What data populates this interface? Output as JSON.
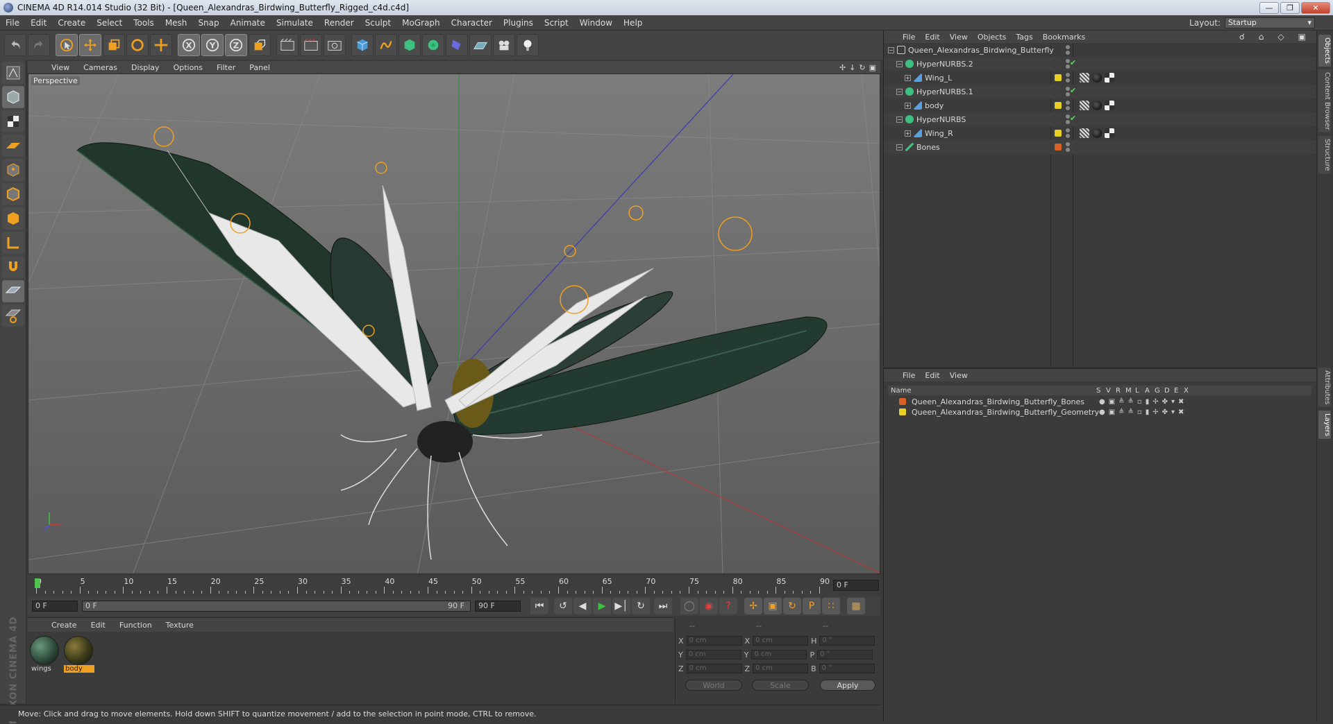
{
  "window": {
    "title": "CINEMA 4D R14.014 Studio (32 Bit) - [Queen_Alexandras_Birdwing_Butterfly_Rigged_c4d.c4d]"
  },
  "menu": [
    "File",
    "Edit",
    "Create",
    "Select",
    "Tools",
    "Mesh",
    "Snap",
    "Animate",
    "Simulate",
    "Render",
    "Sculpt",
    "MoGraph",
    "Character",
    "Plugins",
    "Script",
    "Window",
    "Help"
  ],
  "layout": {
    "label": "Layout:",
    "value": "Startup"
  },
  "viewport": {
    "menu": [
      "View",
      "Cameras",
      "Display",
      "Options",
      "Filter",
      "Panel"
    ],
    "label": "Perspective"
  },
  "timeline": {
    "ticks": [
      "0",
      "5",
      "10",
      "15",
      "20",
      "25",
      "30",
      "35",
      "40",
      "45",
      "50",
      "55",
      "60",
      "65",
      "70",
      "75",
      "80",
      "85",
      "90"
    ],
    "current_frame": "0 F",
    "start": "0 F",
    "range_start": "0 F",
    "range_end": "90 F",
    "end": "90 F"
  },
  "material_manager": {
    "menu": [
      "Create",
      "Edit",
      "Function",
      "Texture"
    ],
    "materials": [
      {
        "name": "wings",
        "selected": false,
        "color": "#2e4a3a"
      },
      {
        "name": "body",
        "selected": true,
        "color": "#3a3a18"
      }
    ]
  },
  "attributes": {
    "header": [
      "--",
      "--",
      "--"
    ],
    "rows": [
      {
        "a": "X",
        "av": "0 cm",
        "b": "X",
        "bv": "0 cm",
        "c": "H",
        "cv": "0 °"
      },
      {
        "a": "Y",
        "av": "0 cm",
        "b": "Y",
        "bv": "0 cm",
        "c": "P",
        "cv": "0 °"
      },
      {
        "a": "Z",
        "av": "0 cm",
        "b": "Z",
        "bv": "0 cm",
        "c": "B",
        "cv": "0 °"
      }
    ],
    "coord_mode": "World",
    "size_mode": "Scale",
    "apply": "Apply"
  },
  "status": "Move: Click and drag to move elements. Hold down SHIFT to quantize movement / add to the selection in point mode, CTRL to remove.",
  "brand": "MAXON CINEMA 4D",
  "object_manager": {
    "menu": [
      "File",
      "Edit",
      "View",
      "Objects",
      "Tags",
      "Bookmarks"
    ],
    "objects": [
      {
        "name": "Queen_Alexandras_Birdwing_Butterfly",
        "depth": 0,
        "layer": "",
        "check": false
      },
      {
        "name": "HyperNURBS.2",
        "depth": 1,
        "layer": "",
        "check": true
      },
      {
        "name": "Wing_L",
        "depth": 2,
        "layer": "#e8d020",
        "check": false,
        "tags": true
      },
      {
        "name": "HyperNURBS.1",
        "depth": 1,
        "layer": "",
        "check": true
      },
      {
        "name": "body",
        "depth": 2,
        "layer": "#e8d020",
        "check": false,
        "tags": true
      },
      {
        "name": "HyperNURBS",
        "depth": 1,
        "layer": "",
        "check": true
      },
      {
        "name": "Wing_R",
        "depth": 2,
        "layer": "#e8d020",
        "check": false,
        "tags": true
      },
      {
        "name": "Bones",
        "depth": 1,
        "layer": "#d86020",
        "check": false
      }
    ]
  },
  "layer_manager": {
    "menu": [
      "File",
      "Edit",
      "View"
    ],
    "columns": [
      "Name",
      "S",
      "V",
      "R",
      "M",
      "L",
      "A",
      "G",
      "D",
      "E",
      "X"
    ],
    "layers": [
      {
        "name": "Queen_Alexandras_Birdwing_Butterfly_Bones",
        "color": "#d86020"
      },
      {
        "name": "Queen_Alexandras_Birdwing_Butterfly_Geometry",
        "color": "#e8d020"
      }
    ]
  },
  "right_tabs": [
    "Objects",
    "Content Browser",
    "Structure",
    "Attributes",
    "Layers"
  ]
}
